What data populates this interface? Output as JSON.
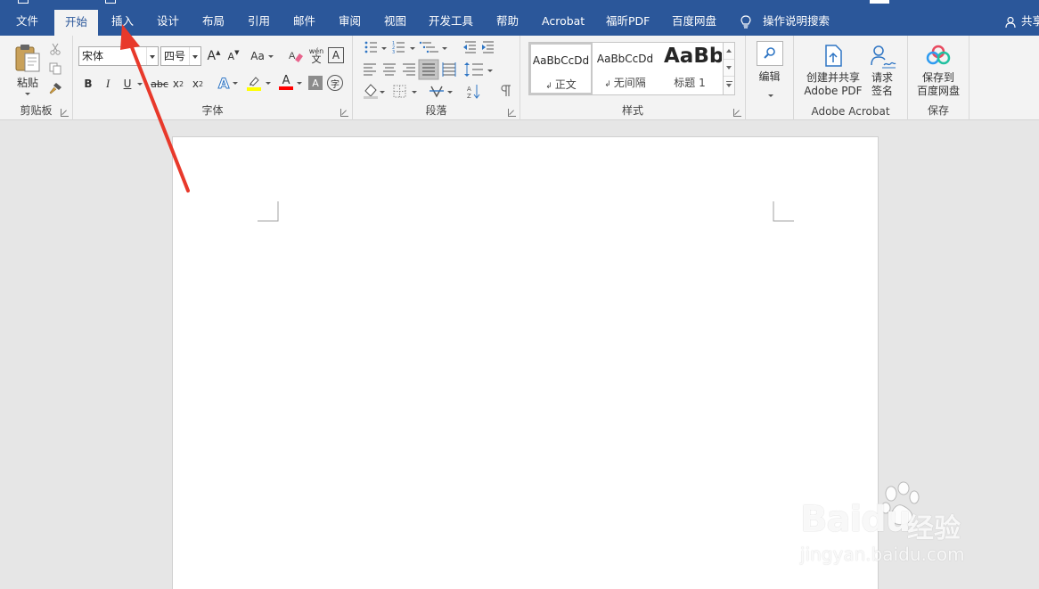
{
  "tabs": {
    "file": "文件",
    "home": "开始",
    "insert": "插入",
    "design": "设计",
    "layout": "布局",
    "references": "引用",
    "mailings": "邮件",
    "review": "审阅",
    "view": "视图",
    "developer": "开发工具",
    "help": "帮助",
    "acrobat": "Acrobat",
    "foxit": "福昕PDF",
    "baidu": "百度网盘"
  },
  "tell_me": "操作说明搜索",
  "share": "共享",
  "clipboard": {
    "paste_label": "粘贴",
    "group_label": "剪贴板"
  },
  "font": {
    "font_name": "宋体",
    "font_size": "四号",
    "grow_label": "A",
    "shrink_label": "A",
    "case_label": "Aa",
    "phonetic_top": "wén",
    "phonetic_bottom": "文",
    "border_char_label": "A",
    "bold": "B",
    "italic": "I",
    "underline": "U",
    "strikethrough": "abc",
    "subscript_base": "x",
    "subscript_mark": "2",
    "superscript_base": "x",
    "superscript_mark": "2",
    "effects_label": "A",
    "font_color_label": "A",
    "shading_label": "A",
    "enclose_label": "字",
    "group_label": "字体"
  },
  "paragraph": {
    "group_label": "段落"
  },
  "styles": {
    "items": [
      {
        "sample": "AaBbCcDd",
        "name": "正文"
      },
      {
        "sample": "AaBbCcDd",
        "name": "无间隔"
      },
      {
        "sample": "AaBb",
        "name": "标题 1"
      }
    ],
    "group_label": "样式"
  },
  "editing": {
    "label": "编辑"
  },
  "adobe": {
    "create_line1": "创建并共享",
    "create_line2": "Adobe PDF",
    "sign_line1": "请求",
    "sign_line2": "签名",
    "group_label": "Adobe Acrobat"
  },
  "baidu_save": {
    "line1": "保存到",
    "line2": "百度网盘",
    "group_label": "保存"
  },
  "watermark": {
    "brand": "Baidu",
    "jingyan": "经验",
    "url": "jingyan.baidu.com"
  },
  "colors": {
    "ribbon_blue": "#2b579a",
    "highlight_yellow": "#ffff00",
    "font_red": "#ff0000",
    "arrow_red": "#e8392b"
  }
}
